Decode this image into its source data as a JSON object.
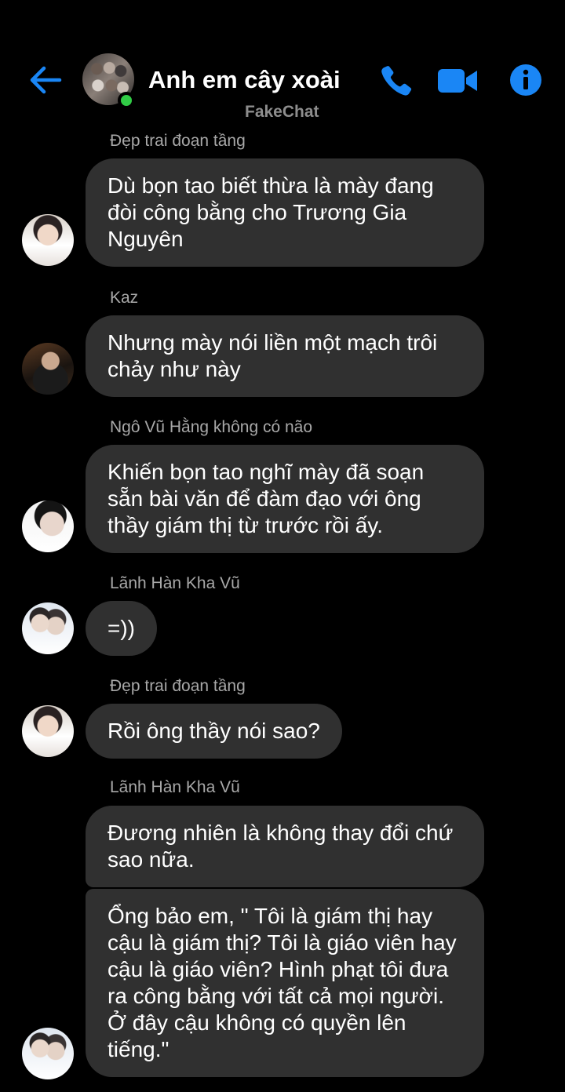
{
  "header": {
    "group_name": "Anh em cây xoài",
    "watermark": "FakeChat",
    "accent": "#1a86f5",
    "online_color": "#31cc46",
    "icons": [
      "back-arrow-icon",
      "phone-icon",
      "video-camera-icon",
      "info-icon"
    ]
  },
  "messages": [
    {
      "sender": "Đẹp trai đoạn tầng",
      "bubbles": [
        "Dù bọn tao biết thừa là mày đang đòi công bằng cho Trương Gia Nguyên"
      ]
    },
    {
      "sender": "Kaz",
      "bubbles": [
        "Nhưng mày nói liền một mạch trôi chảy như này"
      ]
    },
    {
      "sender": "Ngô Vũ Hằng không có não",
      "bubbles": [
        "Khiến bọn tao nghĩ mày đã soạn sẵn bài văn để đàm đạo với ông thầy giám thị từ trước rồi ấy."
      ]
    },
    {
      "sender": "Lãnh Hàn Kha Vũ",
      "bubbles": [
        "=))"
      ]
    },
    {
      "sender": "Đẹp trai đoạn tầng",
      "bubbles": [
        "Rồi ông thầy nói sao?"
      ]
    },
    {
      "sender": "Lãnh Hàn Kha Vũ",
      "bubbles": [
        "Đương nhiên là không thay đổi chứ sao nữa.",
        "Ổng bảo em, \" Tôi là giám thị hay cậu là giám thị? Tôi là giáo viên hay cậu là giáo viên? Hình phạt tôi đưa ra công bằng với tất cả mọi người. Ở đây cậu không có quyền lên tiếng.\""
      ]
    }
  ]
}
